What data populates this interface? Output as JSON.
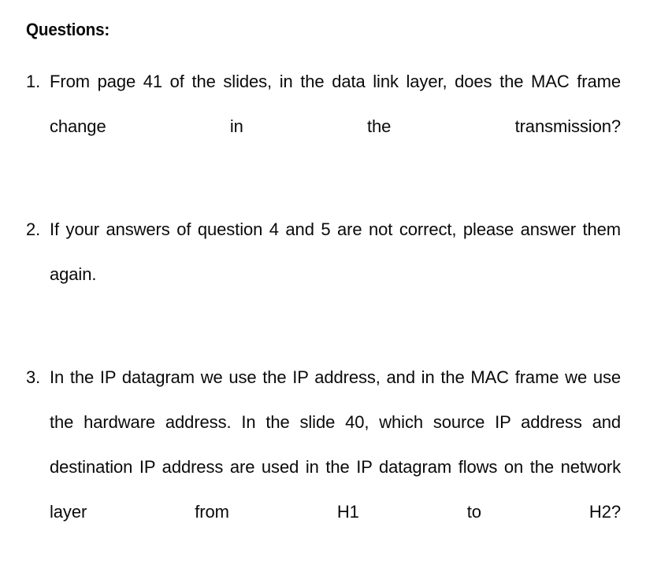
{
  "document": {
    "heading": "Questions:",
    "background_color": "#ffffff",
    "text_color": "#0a0a0a",
    "questions": [
      {
        "marker": "1.",
        "text": "From page 41 of the slides, in the data link layer, does the MAC frame change in the transmission?"
      },
      {
        "marker": "2.",
        "text": "If your answers of question 4 and 5 are not correct, please answer them again."
      },
      {
        "marker": "3.",
        "text": "In the IP datagram we use the IP address, and in the MAC frame we use the hardware address. In the slide 40, which source IP address and destination IP address are used in the IP datagram flows on the network layer from H1 to H2?"
      }
    ]
  }
}
